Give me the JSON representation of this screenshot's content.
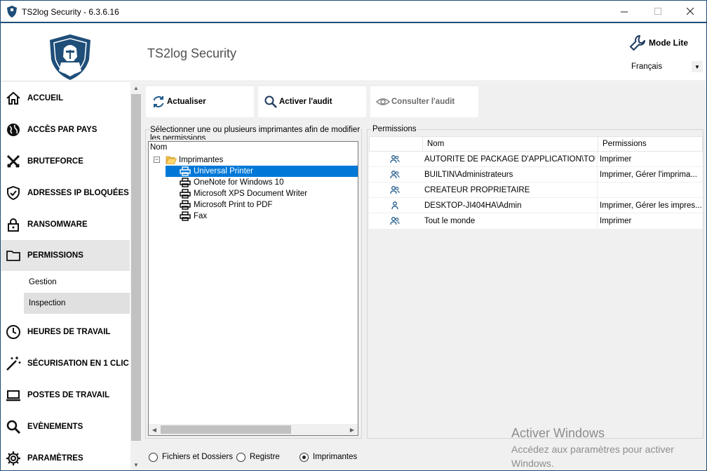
{
  "window": {
    "title": "TS2log Security - 6.3.6.16"
  },
  "header": {
    "app_title": "TS2log Security",
    "mode_label": "Mode Lite",
    "language": "Français"
  },
  "sidebar": {
    "items": [
      {
        "label": "ACCUEIL",
        "icon": "home-icon"
      },
      {
        "label": "ACCÈS PAR PAYS",
        "icon": "globe-icon"
      },
      {
        "label": "BRUTEFORCE",
        "icon": "swords-icon"
      },
      {
        "label": "ADRESSES IP BLOQUÉES",
        "icon": "shield-check-icon"
      },
      {
        "label": "RANSOMWARE",
        "icon": "lock-icon"
      },
      {
        "label": "PERMISSIONS",
        "icon": "folder-icon",
        "active": true
      },
      {
        "label": "HEURES DE TRAVAIL",
        "icon": "clock-icon"
      },
      {
        "label": "SÉCURISATION EN 1 CLIC",
        "icon": "magic-wand-icon"
      },
      {
        "label": "POSTES DE TRAVAIL",
        "icon": "laptop-icon"
      },
      {
        "label": "EVÈNEMENTS",
        "icon": "search-icon"
      },
      {
        "label": "PARAMÈTRES",
        "icon": "gear-icon"
      }
    ],
    "sub_items": [
      {
        "label": "Gestion"
      },
      {
        "label": "Inspection",
        "active": true
      }
    ]
  },
  "toolbar": {
    "refresh_label": "Actualiser",
    "enable_audit_label": "Activer l'audit",
    "view_audit_label": "Consulter l'audit"
  },
  "left_panel": {
    "title": "Sélectionner une ou plusieurs imprimantes afin de modifier les permissions",
    "column": "Nom",
    "root_label": "Imprimantes",
    "printers": [
      "Universal Printer",
      "OneNote for Windows 10",
      "Microsoft XPS Document Writer",
      "Microsoft Print to PDF",
      "Fax"
    ],
    "selected_printer": "Universal Printer"
  },
  "permissions_panel": {
    "title": "Permissions",
    "columns": {
      "name": "Nom",
      "permissions": "Permissions"
    },
    "rows": [
      {
        "type": "group",
        "name": "AUTORITÉ DE PACKAGE D'APPLICATION\\TOUS ...",
        "permissions": "Imprimer"
      },
      {
        "type": "group",
        "name": "BUILTIN\\Administrateurs",
        "permissions": "Imprimer, Gérer l'imprima..."
      },
      {
        "type": "group",
        "name": "CREATEUR PROPRIETAIRE",
        "permissions": ""
      },
      {
        "type": "user",
        "name": "DESKTOP-JI404HA\\Admin",
        "permissions": "Imprimer, Gérer les impres..."
      },
      {
        "type": "group",
        "name": "Tout le monde",
        "permissions": "Imprimer"
      }
    ]
  },
  "scope_options": {
    "files": "Fichiers et Dossiers",
    "registry": "Registre",
    "printers": "Imprimantes",
    "selected": "printers"
  },
  "watermark": {
    "line1": "Activer Windows",
    "line2": "Accédez aux paramètres pour activer Windows."
  },
  "colors": {
    "accent": "#1f4e79",
    "selection": "#0078d7",
    "icon_blue": "#1f5a8c"
  }
}
